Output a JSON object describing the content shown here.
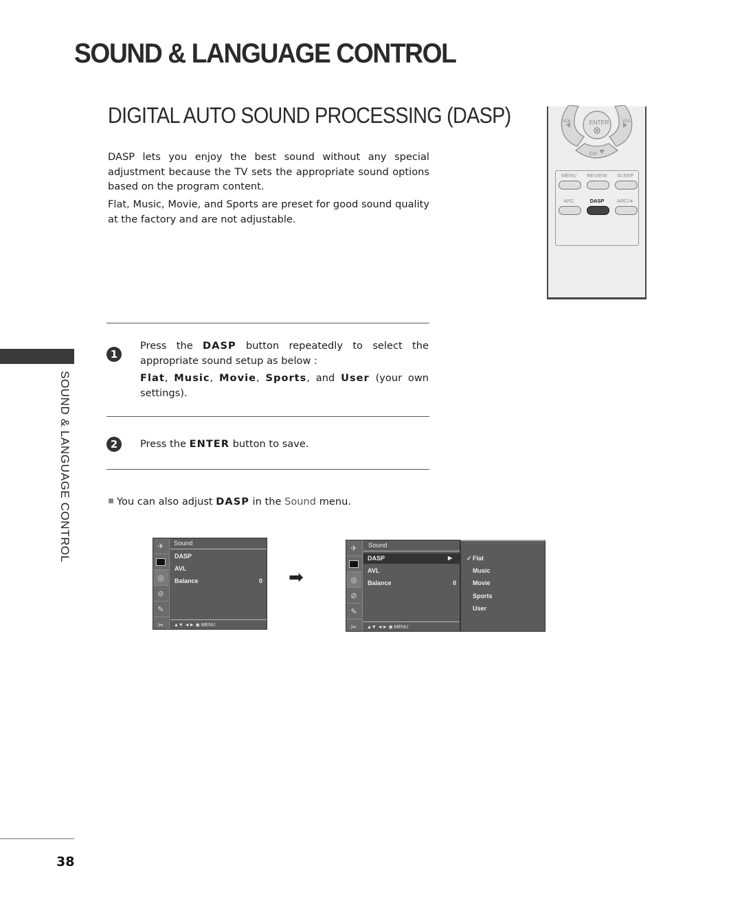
{
  "header": {
    "title": "SOUND & LANGUAGE CONTROL",
    "section_title": "DIGITAL AUTO SOUND PROCESSING (DASP)"
  },
  "intro": {
    "paragraph_1": "DASP lets you enjoy the best sound without any special adjustment because the TV sets the appropriate sound options based on the program content.",
    "paragraph_2": "Flat, Music, Movie, and Sports are preset for good sound quality at the factory and are not adjustable."
  },
  "remote": {
    "nav": {
      "enter": "ENTER",
      "vol_left": "VOL",
      "vol_right": "VOL",
      "ch": "CH"
    },
    "buttons_row1": [
      "MENU",
      "REVIEW",
      "SLEEP"
    ],
    "buttons_row2": [
      "APC",
      "DASP",
      "ARC/∗"
    ],
    "highlighted": "DASP"
  },
  "steps": [
    {
      "number": "1",
      "text_pre": "Press the ",
      "keyword": "DASP",
      "text_post": " button repeatedly to select the appropriate sound setup as below :",
      "options": [
        "Flat",
        "Music",
        "Movie",
        "Sports",
        "User"
      ],
      "options_suffix": " (your own settings)."
    },
    {
      "number": "2",
      "text_pre": "Press the ",
      "keyword": "ENTER",
      "text_post": " button to save."
    }
  ],
  "note": {
    "pre": "You can also adjust ",
    "keyword": "DASP",
    "mid": " in the ",
    "menu_name": "Sound",
    "post": " menu."
  },
  "osd_before": {
    "title": "Sound",
    "items": [
      {
        "label": "DASP",
        "value": ""
      },
      {
        "label": "AVL",
        "value": ""
      },
      {
        "label": "Balance",
        "value": "0"
      }
    ],
    "footer": "▲▼  ◄►  ◉  MENU",
    "icons": [
      "antenna-icon",
      "picture-icon",
      "speaker-icon",
      "time-icon",
      "option-icon",
      "lock-icon"
    ]
  },
  "osd_after": {
    "title": "Sound",
    "items": [
      {
        "label": "DASP",
        "value": "▶",
        "selected": true
      },
      {
        "label": "AVL",
        "value": ""
      },
      {
        "label": "Balance",
        "value": "0"
      }
    ],
    "footer": "▲▼  ◄►  ◉  MENU",
    "submenu": [
      {
        "label": "Flat",
        "checked": true
      },
      {
        "label": "Music",
        "checked": false
      },
      {
        "label": "Movie",
        "checked": false
      },
      {
        "label": "Sports",
        "checked": false
      },
      {
        "label": "User",
        "checked": false
      }
    ],
    "check_mark": "✓"
  },
  "sidebar": {
    "label": "SOUND & LANGUAGE CONTROL"
  },
  "footer": {
    "page_number": "38"
  },
  "arrow": "➡"
}
